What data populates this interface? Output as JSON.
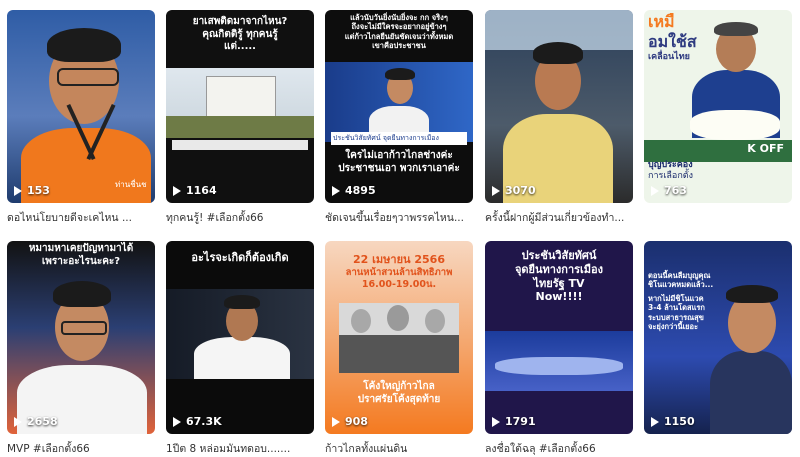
{
  "cards": [
    {
      "views": "153",
      "caption": "ดอไหน่โยบายดีจะเคไหน ...",
      "overlay": [],
      "side": "ท่านชื่นช"
    },
    {
      "views": "1164",
      "caption": "ทุกคนรู้! #เลือกตั้ง66",
      "overlay": [
        "ยาเสพติดมาจากไหน?",
        "คุณกิตติรู้ ทุกคนรู้",
        "แต่....."
      ]
    },
    {
      "views": "4895",
      "caption": "ชัดเจนขึ้นเรื่อยๆวาพรรคไหน...",
      "overlay": [
        "แล้วนับวันยิ่งนับยิ่งจะ กก จริงๆ",
        "ถึงจะไม่มีใครจะอยากอยู่ข้างๆ",
        "แต่ก้าวไกลยืนยันชัดเจนว่าทั้งหมด",
        "เขาคือประชาชน"
      ],
      "bottom": [
        "ใครไม่เอาก้าวไกลช่างค่ะ",
        "ประชาชนเอา พวกเราเอาค่ะ"
      ],
      "tag": "ประชันวิสัยทัศน์ จุดยืนทางการเมือง"
    },
    {
      "views": "3070",
      "caption": "ครั้งนี้ฝากผู้มีส่วนเกี่ยวข้องทำ...",
      "overlay": []
    },
    {
      "views": "763",
      "caption": "",
      "overlay": [
        "เหมื",
        "อมใช้ส",
        "เคลื่อนไทย"
      ],
      "bottom": [
        "บุญประคอง",
        "การเลือกตั้ง"
      ],
      "tag": "K OFF"
    },
    {
      "views": "2658",
      "caption": "MVP #เลือกตั้ง66",
      "overlay": [
        "หมามหาเคยปัญหามาได้",
        "เพราะอะไรนะคะ?"
      ]
    },
    {
      "views": "67.3K",
      "caption": "1ปีต 8 หล่อมมันทดอบ.......",
      "overlay": [
        "อะไรจะเกิดก็ต้องเกิด"
      ]
    },
    {
      "views": "908",
      "caption": "ก้าวไกลทั้งแผ่นดิน",
      "overlay": [
        "22 เมษายน 2566",
        "ลานหน้าสวนล้านสิทธิภาพ",
        "16.00-19.00น."
      ],
      "bottom": [
        "โค้งใหญ่ก้าวไกล",
        "ปราศรัยโค้งสุดท้าย"
      ]
    },
    {
      "views": "1791",
      "caption": "ลงชื่อใต้ฉลุ #เลือกตั้ง66",
      "overlay": [
        "ประชันวิสัยทัศน์",
        "จุดยืนทางการเมือง",
        "ไทยรัฐ TV",
        "Now!!!!"
      ]
    },
    {
      "views": "1150",
      "caption": "",
      "overlay": [
        "ตอนนี้คนลืมบุญคุณ",
        "ชิโนแวคหมดแล้ว...",
        "หากไม่มีชิโนแวค",
        "3-4 ล้านโดสแรก",
        "ระบบสาธารณสุข",
        "จะยุ่งกว่านี้เยอะ"
      ]
    }
  ],
  "colors": {
    "overlay_yellow": "#f2c400",
    "overlay_orange": "#f47a20",
    "overlay_green": "#7ee3a6"
  }
}
